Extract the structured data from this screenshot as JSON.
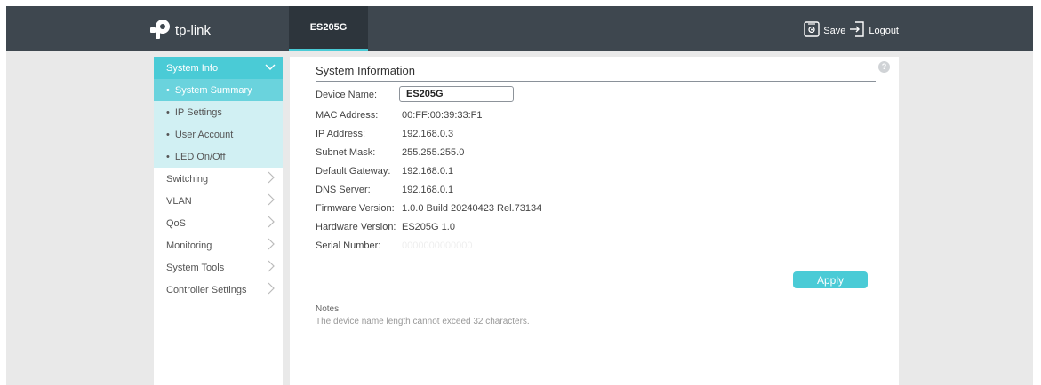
{
  "header": {
    "brand": "tp-link",
    "active_tab": "ES205G",
    "save_label": "Save",
    "logout_label": "Logout",
    "accent_color": "#4acbd6",
    "bar_color": "#3e474f"
  },
  "sidebar": {
    "group_label": "System Info",
    "sub_items": [
      {
        "label": "System Summary",
        "active": true
      },
      {
        "label": "IP Settings"
      },
      {
        "label": "User Account"
      },
      {
        "label": "LED On/Off"
      }
    ],
    "items": [
      {
        "label": "Switching"
      },
      {
        "label": "VLAN"
      },
      {
        "label": "QoS"
      },
      {
        "label": "Monitoring"
      },
      {
        "label": "System Tools"
      },
      {
        "label": "Controller Settings"
      }
    ]
  },
  "main": {
    "section_title": "System Information",
    "help_icon": "?",
    "fields": {
      "device_name": {
        "label": "Device Name:",
        "value": "ES205G"
      },
      "mac_address": {
        "label": "MAC Address:",
        "value": "00:FF:00:39:33:F1"
      },
      "ip_address": {
        "label": "IP Address:",
        "value": "192.168.0.3"
      },
      "subnet_mask": {
        "label": "Subnet Mask:",
        "value": "255.255.255.0"
      },
      "default_gateway": {
        "label": "Default Gateway:",
        "value": "192.168.0.1"
      },
      "dns_server": {
        "label": "DNS Server:",
        "value": "192.168.0.1"
      },
      "firmware_version": {
        "label": "Firmware Version:",
        "value": "1.0.0 Build 20240423 Rel.73134"
      },
      "hardware_version": {
        "label": "Hardware Version:",
        "value": "ES205G 1.0"
      },
      "serial_number": {
        "label": "Serial Number:",
        "value": "0000000000000"
      }
    },
    "apply_label": "Apply",
    "notes_title": "Notes:",
    "notes_text": "The device name length cannot exceed 32 characters."
  }
}
